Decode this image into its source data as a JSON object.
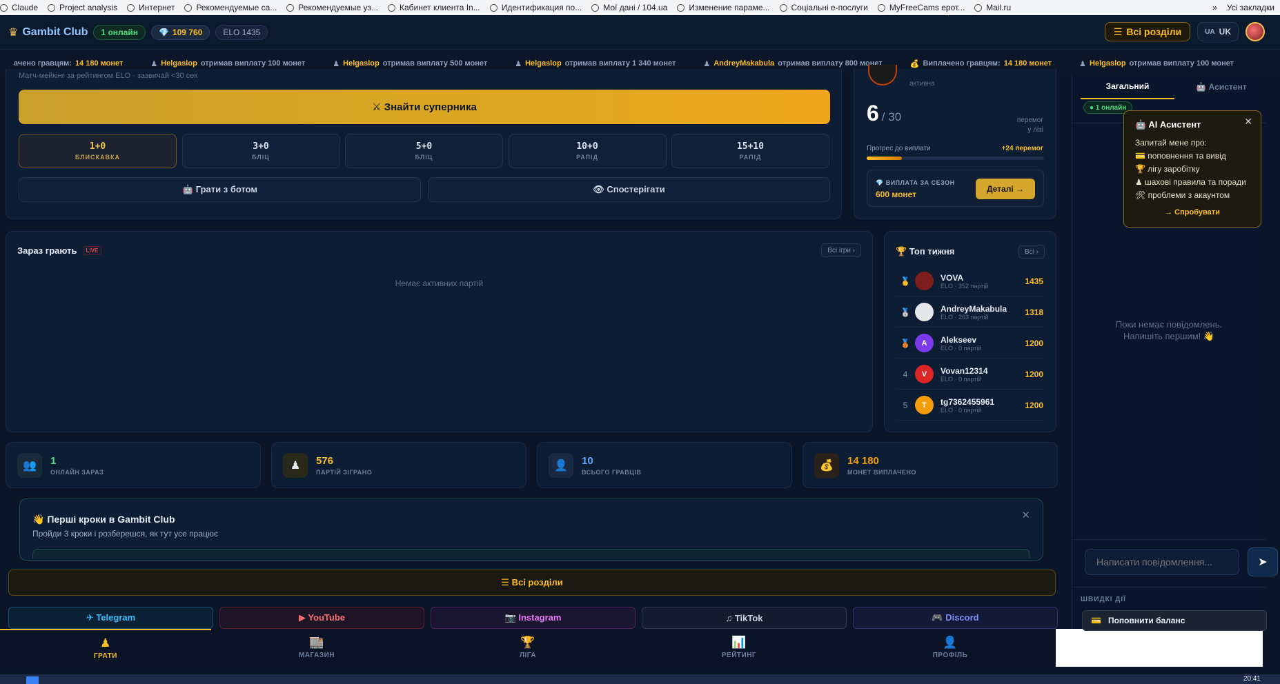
{
  "bookmarks": [
    "Claude",
    "Project analysis",
    "Интернет",
    "Рекомендуемые са...",
    "Рекомендуемые уз...",
    "Кабинет клиента In...",
    "Идентификация по...",
    "Мої дані / 104.ua",
    "Изменение параме...",
    "Соціальні e-послуги",
    "MyFreeCams ерот...",
    "Mail.ru"
  ],
  "bookmarks_right": {
    "chevron": "»",
    "all": "Усі закладки"
  },
  "header": {
    "logo_icon": "♛",
    "logo": "Gambit Club",
    "online": "1 онлайн",
    "coins": "109 760",
    "elo": "ELO 1435",
    "sections": "Всі розділи",
    "lang_code": "UA",
    "lang": "UK"
  },
  "ticker": [
    {
      "pre": "",
      "text_before": "ачено гравцям:",
      "name": "14 180 монет",
      "text_after": ""
    },
    {
      "pre": "♟",
      "name": "Helgaslop",
      "text_after": "отримав виплату 100 монет"
    },
    {
      "pre": "♟",
      "name": "Helgaslop",
      "text_after": "отримав виплату 500 монет"
    },
    {
      "pre": "♟",
      "name": "Helgaslop",
      "text_after": "отримав виплату 1 340 монет"
    },
    {
      "pre": "♟",
      "name": "AndreyMakabula",
      "text_after": "отримав виплату 800 монет"
    },
    {
      "pre": "💰",
      "text_before": "Виплачено гравцям:",
      "name": "14 180 монет",
      "text_after": ""
    },
    {
      "pre": "♟",
      "name": "Helgaslop",
      "text_after": "отримав виплату 100 монет"
    }
  ],
  "play": {
    "matchmaking_note": "Матч-мейкінг за рейтингом ELO · зазвичай <30 сек",
    "find_opponent": "⚔ Знайти суперника",
    "time_controls": [
      {
        "time": "1+0",
        "label": "БЛИСКАВКА"
      },
      {
        "time": "3+0",
        "label": "БЛІЦ"
      },
      {
        "time": "5+0",
        "label": "БЛІЦ"
      },
      {
        "time": "10+0",
        "label": "РАПІД"
      },
      {
        "time": "15+10",
        "label": "РАПІД"
      }
    ],
    "play_bot": "🤖 Грати з ботом",
    "spectate": "👁 Спостерігати"
  },
  "league": {
    "status": "активна",
    "wins": "6",
    "wins_total": "/ 30",
    "wins_label_1": "перемог",
    "wins_label_2": "у лізі",
    "progress_label": "Прогрес до виплати",
    "progress_right": "+24 перемог",
    "progress": 0.2,
    "season_label": "💎 ВИПЛАТА ЗА СЕЗОН",
    "season_value": "600 монет",
    "details": "Деталі →"
  },
  "live": {
    "title": "Зараз грають",
    "badge": "LIVE",
    "all_games": "Всі ігри ›",
    "empty": "Немає активних партій"
  },
  "top_week": {
    "title": "🏆 Топ тижня",
    "all": "Всі ›",
    "rows": [
      {
        "rank": "🥇",
        "avatar": "",
        "name": "VOVA",
        "sub": "ELO · 352 партій",
        "score": "1435",
        "color": "#7f1d1d"
      },
      {
        "rank": "🥈",
        "avatar": "",
        "name": "AndreyMakabula",
        "sub": "ELO · 263 партій",
        "score": "1318",
        "color": "#e5e7eb"
      },
      {
        "rank": "🥉",
        "avatar": "A",
        "name": "Alekseev",
        "sub": "ELO · 0 партій",
        "score": "1200",
        "color": "#7c3aed"
      },
      {
        "rank": "4",
        "avatar": "V",
        "name": "Vovan12314",
        "sub": "ELO · 0 партій",
        "score": "1200",
        "color": "#dc2626"
      },
      {
        "rank": "5",
        "avatar": "T",
        "name": "tg7362455961",
        "sub": "ELO · 0 партій",
        "score": "1200",
        "color": "#f59e0b"
      }
    ]
  },
  "stats": [
    {
      "icon": "👥",
      "value": "1",
      "label": "ОНЛАЙН ЗАРАЗ",
      "color": "#4ade80",
      "bg": "#1a2a3a"
    },
    {
      "icon": "♟",
      "value": "576",
      "label": "ПАРТІЙ ЗІГРАНО",
      "color": "#fbbf24",
      "bg": "#2a2a1a"
    },
    {
      "icon": "👤",
      "value": "10",
      "label": "ВСЬОГО ГРАВЦІВ",
      "color": "#60a5fa",
      "bg": "#1a2a45"
    },
    {
      "icon": "💰",
      "value": "14 180",
      "label": "МОНЕТ ВИПЛАЧЕНО",
      "color": "#f59e0b",
      "bg": "#2a221a"
    }
  ],
  "onboarding": {
    "title": "👋 Перші кроки в Gambit Club",
    "subtitle": "Пройди 3 кроки і розберешся, як тут усе працює"
  },
  "all_sections": "☰  Всі розділи",
  "socials": [
    {
      "label": "✈ Telegram",
      "color": "#38bdf8",
      "border": "#1e4a6e",
      "bg": "#0c2036"
    },
    {
      "label": "▶ YouTube",
      "color": "#f87171",
      "border": "#5a2030",
      "bg": "#1e1426"
    },
    {
      "label": "📷 Instagram",
      "color": "#e879f9",
      "border": "#4a2358",
      "bg": "#1a1630"
    },
    {
      "label": "♫ TikTok",
      "color": "#cbd5e1",
      "border": "#2d3b52",
      "bg": "#121c2e"
    },
    {
      "label": "🎮 Discord",
      "color": "#818cf8",
      "border": "#2f3470",
      "bg": "#121a38"
    }
  ],
  "bottom_nav": [
    {
      "icon": "♟",
      "label": "ГРАТИ"
    },
    {
      "icon": "🏬",
      "label": "МАГАЗИН"
    },
    {
      "icon": "🏆",
      "label": "ЛІГА"
    },
    {
      "icon": "📊",
      "label": "РЕЙТИНГ"
    },
    {
      "icon": "👤",
      "label": "ПРОФІЛЬ"
    }
  ],
  "chat": {
    "tab_general": "Загальний",
    "tab_assistant": "🤖 Асистент",
    "online": "● 1 онлайн",
    "empty_1": "Поки немає повідомлень.",
    "empty_2": "Напишіть першим! 👋",
    "placeholder": "Написати повідомлення...",
    "send": "➤",
    "quick_title": "ШВИДКІ ДІЇ",
    "quick_topup": "Поповнити баланс",
    "quick_topup_icon": "💳"
  },
  "ai_popup": {
    "title": "🤖 AI Асистент",
    "intro": "Запитай мене про:",
    "items": [
      "💳 поповнення та вивід",
      "🏆 лігу заробітку",
      "♟ шахові правила та поради",
      "🛠 проблеми з акаунтом"
    ],
    "try": "→ Спробувати",
    "close": "✕"
  },
  "taskbar": {
    "time": "20:41"
  }
}
